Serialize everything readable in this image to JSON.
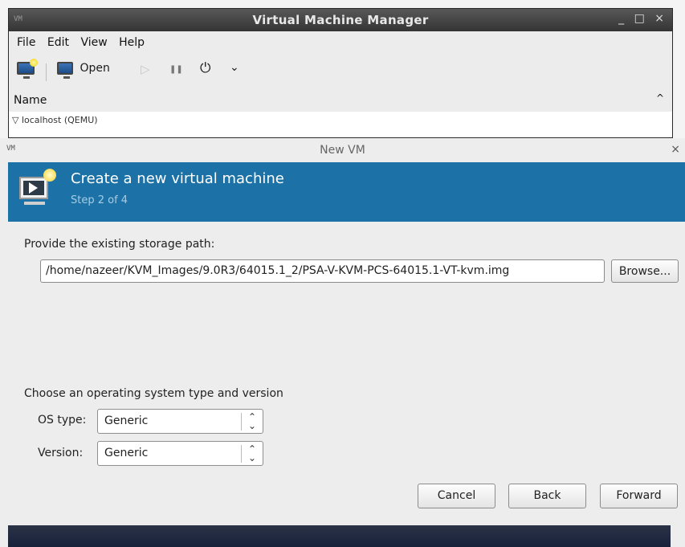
{
  "main_window": {
    "title": "Virtual Machine Manager",
    "window_icon_text": "VM",
    "controls": "_ □ ×",
    "menu": [
      "File",
      "Edit",
      "View",
      "Help"
    ],
    "toolbar": {
      "open_label": "Open",
      "play_glyph": "▷",
      "pause_glyph": "❚❚",
      "power_glyph": "⏻",
      "dropdown_glyph": "⌄"
    },
    "list": {
      "column_header": "Name",
      "sort_glyph": "^",
      "row_text": "▽  localhost (QEMU)"
    }
  },
  "dialog": {
    "title": "New VM",
    "window_icon_text": "VM",
    "close_glyph": "×",
    "banner": {
      "title": "Create a new virtual machine",
      "subtitle": "Step 2 of 4"
    },
    "storage": {
      "label": "Provide the existing storage path:",
      "path_value": "/home/nazeer/KVM_Images/9.0R3/64015.1_2/PSA-V-KVM-PCS-64015.1-VT-kvm.img",
      "browse_label": "Browse..."
    },
    "os": {
      "section_label": "Choose an operating system type and version",
      "type_label": "OS type:",
      "type_value": "Generic",
      "version_label": "Version:",
      "version_value": "Generic",
      "spinner_glyph": "⌃⌄"
    },
    "buttons": {
      "cancel": "Cancel",
      "back": "Back",
      "forward": "Forward"
    }
  },
  "colors": {
    "banner": "#1c71a6",
    "titlebar": "#3a3a3a",
    "bottom_bar": "#1b2540"
  }
}
